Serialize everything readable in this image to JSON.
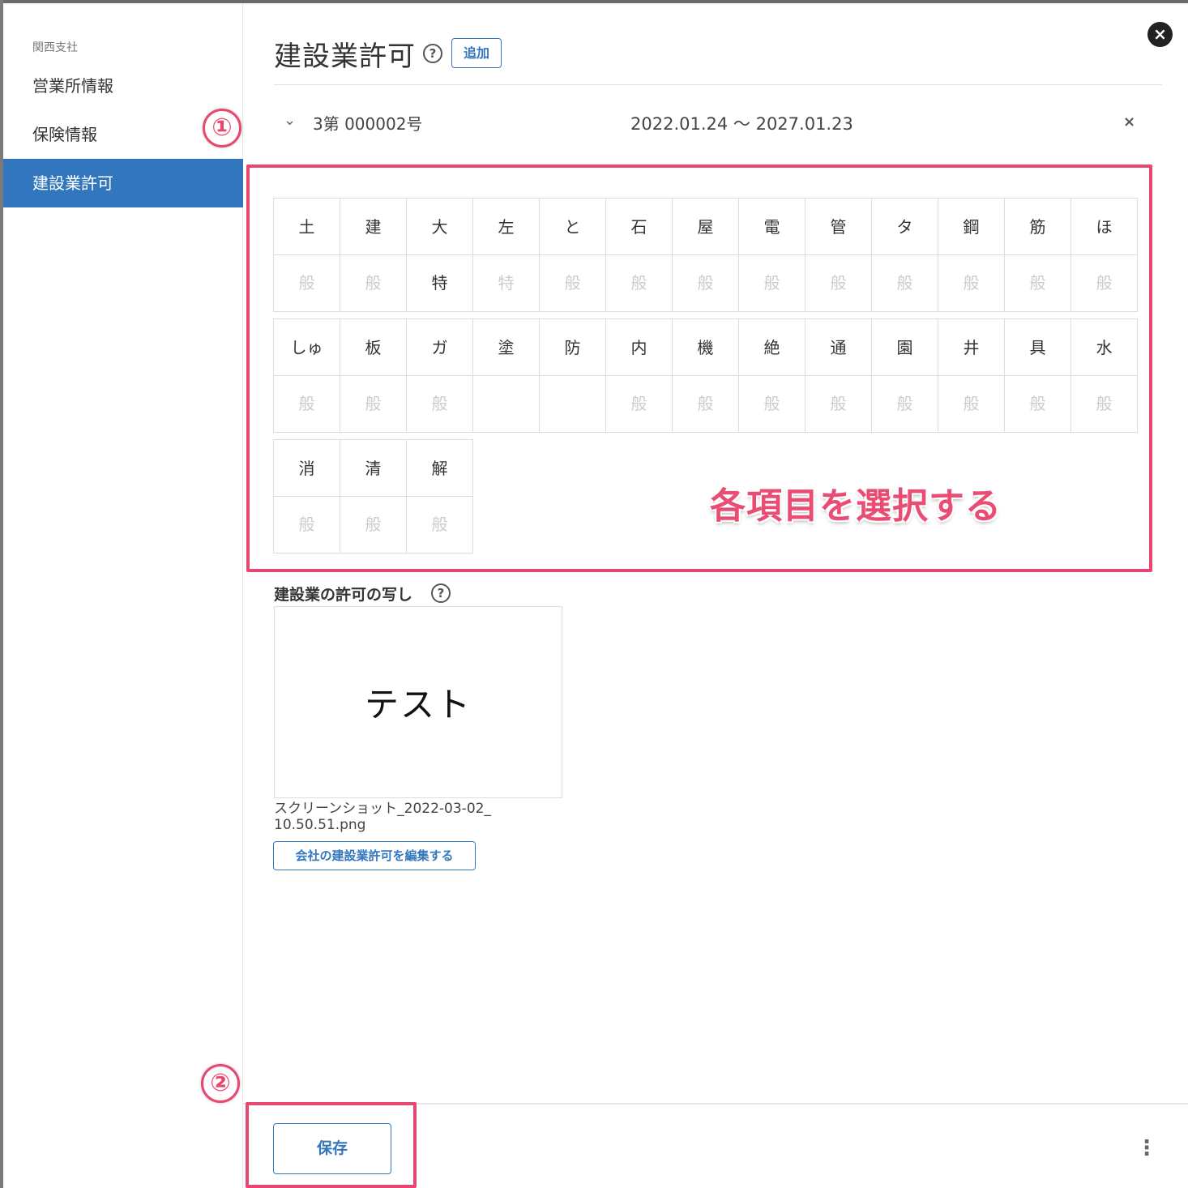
{
  "sidebar": {
    "org": "関西支社",
    "items": [
      {
        "label": "営業所情報"
      },
      {
        "label": "保険情報"
      },
      {
        "label": "建設業許可"
      }
    ]
  },
  "header": {
    "title": "建設業許可",
    "help": "?",
    "add_label": "追加",
    "close_icon": "×"
  },
  "license": {
    "chevron": "⌄",
    "number": "3第 000002号",
    "period": "2022.01.24 〜 2027.01.23",
    "remove": "×"
  },
  "grid": {
    "rows": [
      [
        {
          "top": "土",
          "bottom": "般"
        },
        {
          "top": "建",
          "bottom": "般"
        },
        {
          "top": "大",
          "bottom": "特"
        },
        {
          "top": "左",
          "bottom": "特"
        },
        {
          "top": "と",
          "bottom": "般"
        },
        {
          "top": "石",
          "bottom": "般"
        },
        {
          "top": "屋",
          "bottom": "般"
        },
        {
          "top": "電",
          "bottom": "般"
        },
        {
          "top": "管",
          "bottom": "般"
        },
        {
          "top": "タ",
          "bottom": "般"
        },
        {
          "top": "鋼",
          "bottom": "般"
        },
        {
          "top": "筋",
          "bottom": "般"
        },
        {
          "top": "ほ",
          "bottom": "般"
        }
      ],
      [
        {
          "top": "しゅ",
          "bottom": "般"
        },
        {
          "top": "板",
          "bottom": "般"
        },
        {
          "top": "ガ",
          "bottom": "般"
        },
        {
          "top": "塗",
          "bottom": ""
        },
        {
          "top": "防",
          "bottom": ""
        },
        {
          "top": "内",
          "bottom": "般"
        },
        {
          "top": "機",
          "bottom": "般"
        },
        {
          "top": "絶",
          "bottom": "般"
        },
        {
          "top": "通",
          "bottom": "般"
        },
        {
          "top": "園",
          "bottom": "般"
        },
        {
          "top": "井",
          "bottom": "般"
        },
        {
          "top": "具",
          "bottom": "般"
        },
        {
          "top": "水",
          "bottom": "般"
        }
      ],
      [
        {
          "top": "消",
          "bottom": "般"
        },
        {
          "top": "清",
          "bottom": "般"
        },
        {
          "top": "解",
          "bottom": "般"
        }
      ]
    ]
  },
  "annotation": {
    "marker1": "①",
    "marker2": "②",
    "text": "各項目を選択する"
  },
  "attachment": {
    "label": "建設業の許可の写し",
    "help": "?",
    "thumb_text": "テスト",
    "file_name": "スクリーンショット_2022-03-02_10.50.51.png",
    "edit_label": "会社の建設業許可を編集する"
  },
  "footer": {
    "save_label": "保存",
    "more_icon": "⋮"
  },
  "colors": {
    "accent": "#3277bd",
    "highlight": "#e8476f"
  }
}
